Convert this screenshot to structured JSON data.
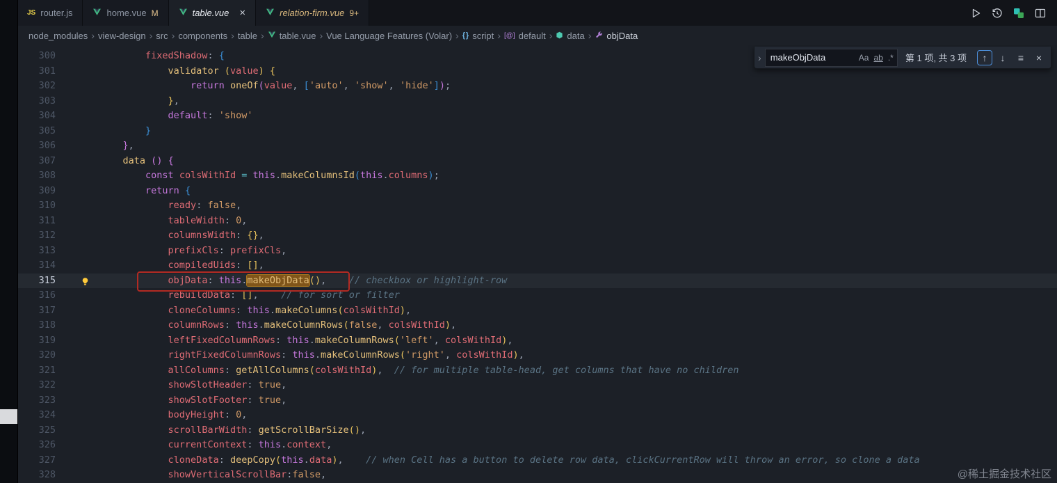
{
  "tabs": [
    {
      "label": "router.js",
      "icon": "js",
      "modified": "",
      "active": false
    },
    {
      "label": "home.vue",
      "icon": "vue",
      "modified": "M",
      "active": false
    },
    {
      "label": "table.vue",
      "icon": "vue",
      "active": true,
      "close": "×"
    },
    {
      "label": "relation-firm.vue",
      "icon": "vue",
      "badge": "9+",
      "active": false
    }
  ],
  "breadcrumb": {
    "separator": "›",
    "items": [
      {
        "label": "node_modules"
      },
      {
        "label": "view-design"
      },
      {
        "label": "src"
      },
      {
        "label": "components"
      },
      {
        "label": "table"
      },
      {
        "label": "table.vue",
        "icon": "vue"
      },
      {
        "label": "Vue Language Features (Volar)"
      },
      {
        "label": "script",
        "icon": "braces"
      },
      {
        "label": "default",
        "icon": "at"
      },
      {
        "label": "data",
        "icon": "field"
      },
      {
        "label": "objData",
        "icon": "wrench"
      }
    ]
  },
  "find": {
    "query": "makeObjData",
    "match_case": "Aa",
    "whole_word": "ab",
    "regex": ".*",
    "results": "第 1 项, 共 3 项"
  },
  "icons": {
    "js_badge": "JS",
    "close": "×",
    "chevron_right": "›",
    "arrow_up": "↑",
    "arrow_down": "↓",
    "selection_lines": "≡"
  },
  "colors": {
    "vue_green": "#41b883",
    "modified_badge": "#e2c08d",
    "find_match_bg": "#80551a",
    "annotation_red": "#b22a23",
    "editor_bg": "#1c2027"
  },
  "watermark": {
    "text": "@稀土掘金技术社区"
  },
  "editor": {
    "lines": [
      {
        "n": 300,
        "t": [
          [
            "        ",
            "w"
          ],
          [
            "fixedShadow",
            "v"
          ],
          [
            ":",
            "p"
          ],
          [
            " ",
            "w"
          ],
          [
            "{",
            "b3"
          ]
        ]
      },
      {
        "n": 301,
        "t": [
          [
            "            ",
            "w"
          ],
          [
            "validator",
            "f"
          ],
          [
            " ",
            "w"
          ],
          [
            "(",
            "b1"
          ],
          [
            "value",
            "v"
          ],
          [
            ")",
            "b1"
          ],
          [
            " ",
            "w"
          ],
          [
            "{",
            "b1"
          ]
        ]
      },
      {
        "n": 302,
        "t": [
          [
            "                ",
            "w"
          ],
          [
            "return",
            "k"
          ],
          [
            " ",
            "w"
          ],
          [
            "oneOf",
            "f"
          ],
          [
            "(",
            "b2"
          ],
          [
            "value",
            "v"
          ],
          [
            ",",
            "p"
          ],
          [
            " ",
            "w"
          ],
          [
            "[",
            "b3"
          ],
          [
            "'auto'",
            "s"
          ],
          [
            ",",
            "p"
          ],
          [
            " ",
            "w"
          ],
          [
            "'show'",
            "s"
          ],
          [
            ",",
            "p"
          ],
          [
            " ",
            "w"
          ],
          [
            "'hide'",
            "s"
          ],
          [
            "]",
            "b3"
          ],
          [
            ")",
            "b2"
          ],
          [
            ";",
            "p"
          ]
        ]
      },
      {
        "n": 303,
        "t": [
          [
            "            ",
            "w"
          ],
          [
            "}",
            "b1"
          ],
          [
            ",",
            "p"
          ]
        ]
      },
      {
        "n": 304,
        "t": [
          [
            "            ",
            "w"
          ],
          [
            "default",
            "k"
          ],
          [
            ":",
            "p"
          ],
          [
            " ",
            "w"
          ],
          [
            "'show'",
            "s"
          ]
        ]
      },
      {
        "n": 305,
        "t": [
          [
            "        ",
            "w"
          ],
          [
            "}",
            "b3"
          ]
        ]
      },
      {
        "n": 306,
        "t": [
          [
            "    ",
            "w"
          ],
          [
            "}",
            "b2"
          ],
          [
            ",",
            "p"
          ]
        ]
      },
      {
        "n": 307,
        "t": [
          [
            "    ",
            "w"
          ],
          [
            "data",
            "f"
          ],
          [
            " ",
            "w"
          ],
          [
            "(",
            "b2"
          ],
          [
            ")",
            "b2"
          ],
          [
            " ",
            "w"
          ],
          [
            "{",
            "b2"
          ]
        ]
      },
      {
        "n": 308,
        "t": [
          [
            "        ",
            "w"
          ],
          [
            "const",
            "k"
          ],
          [
            " ",
            "w"
          ],
          [
            "colsWithId",
            "v"
          ],
          [
            " ",
            "w"
          ],
          [
            "=",
            "o"
          ],
          [
            " ",
            "w"
          ],
          [
            "this",
            "k"
          ],
          [
            ".",
            "p"
          ],
          [
            "makeColumnsId",
            "f"
          ],
          [
            "(",
            "b3"
          ],
          [
            "this",
            "k"
          ],
          [
            ".",
            "p"
          ],
          [
            "columns",
            "v"
          ],
          [
            ")",
            "b3"
          ],
          [
            ";",
            "p"
          ]
        ]
      },
      {
        "n": 309,
        "t": [
          [
            "        ",
            "w"
          ],
          [
            "return",
            "k"
          ],
          [
            " ",
            "w"
          ],
          [
            "{",
            "b3"
          ]
        ]
      },
      {
        "n": 310,
        "t": [
          [
            "            ",
            "w"
          ],
          [
            "ready",
            "v"
          ],
          [
            ":",
            "p"
          ],
          [
            " ",
            "w"
          ],
          [
            "false",
            "n"
          ],
          [
            ",",
            "p"
          ]
        ]
      },
      {
        "n": 311,
        "t": [
          [
            "            ",
            "w"
          ],
          [
            "tableWidth",
            "v"
          ],
          [
            ":",
            "p"
          ],
          [
            " ",
            "w"
          ],
          [
            "0",
            "n"
          ],
          [
            ",",
            "p"
          ]
        ]
      },
      {
        "n": 312,
        "t": [
          [
            "            ",
            "w"
          ],
          [
            "columnsWidth",
            "v"
          ],
          [
            ":",
            "p"
          ],
          [
            " ",
            "w"
          ],
          [
            "{}",
            "b1"
          ],
          [
            ",",
            "p"
          ]
        ]
      },
      {
        "n": 313,
        "t": [
          [
            "            ",
            "w"
          ],
          [
            "prefixCls",
            "v"
          ],
          [
            ":",
            "p"
          ],
          [
            " ",
            "w"
          ],
          [
            "prefixCls",
            "v"
          ],
          [
            ",",
            "p"
          ]
        ]
      },
      {
        "n": 314,
        "t": [
          [
            "            ",
            "w"
          ],
          [
            "compiledUids",
            "v"
          ],
          [
            ":",
            "p"
          ],
          [
            " ",
            "w"
          ],
          [
            "[]",
            "b1"
          ],
          [
            ",",
            "p"
          ]
        ]
      },
      {
        "n": 315,
        "cur": true,
        "bulb": true,
        "t": [
          [
            "            ",
            "w"
          ],
          [
            "objData",
            "v"
          ],
          [
            ":",
            "p"
          ],
          [
            " ",
            "w"
          ],
          [
            "this",
            "k"
          ],
          [
            ".",
            "p"
          ],
          [
            "makeObjData",
            "f hl"
          ],
          [
            "(",
            "b1"
          ],
          [
            ")",
            "b1"
          ],
          [
            ",",
            "p"
          ],
          [
            "    ",
            "w"
          ],
          [
            "// checkbox or highlight-row",
            "c"
          ]
        ]
      },
      {
        "n": 316,
        "t": [
          [
            "            ",
            "w"
          ],
          [
            "rebuildData",
            "v"
          ],
          [
            ":",
            "p"
          ],
          [
            " ",
            "w"
          ],
          [
            "[]",
            "b1"
          ],
          [
            ",",
            "p"
          ],
          [
            "    ",
            "w"
          ],
          [
            "// for sort or filter",
            "c"
          ]
        ]
      },
      {
        "n": 317,
        "t": [
          [
            "            ",
            "w"
          ],
          [
            "cloneColumns",
            "v"
          ],
          [
            ":",
            "p"
          ],
          [
            " ",
            "w"
          ],
          [
            "this",
            "k"
          ],
          [
            ".",
            "p"
          ],
          [
            "makeColumns",
            "f"
          ],
          [
            "(",
            "b1"
          ],
          [
            "colsWithId",
            "v"
          ],
          [
            ")",
            "b1"
          ],
          [
            ",",
            "p"
          ]
        ]
      },
      {
        "n": 318,
        "t": [
          [
            "            ",
            "w"
          ],
          [
            "columnRows",
            "v"
          ],
          [
            ":",
            "p"
          ],
          [
            " ",
            "w"
          ],
          [
            "this",
            "k"
          ],
          [
            ".",
            "p"
          ],
          [
            "makeColumnRows",
            "f"
          ],
          [
            "(",
            "b1"
          ],
          [
            "false",
            "n"
          ],
          [
            ",",
            "p"
          ],
          [
            " ",
            "w"
          ],
          [
            "colsWithId",
            "v"
          ],
          [
            ")",
            "b1"
          ],
          [
            ",",
            "p"
          ]
        ]
      },
      {
        "n": 319,
        "t": [
          [
            "            ",
            "w"
          ],
          [
            "leftFixedColumnRows",
            "v"
          ],
          [
            ":",
            "p"
          ],
          [
            " ",
            "w"
          ],
          [
            "this",
            "k"
          ],
          [
            ".",
            "p"
          ],
          [
            "makeColumnRows",
            "f"
          ],
          [
            "(",
            "b1"
          ],
          [
            "'left'",
            "s"
          ],
          [
            ",",
            "p"
          ],
          [
            " ",
            "w"
          ],
          [
            "colsWithId",
            "v"
          ],
          [
            ")",
            "b1"
          ],
          [
            ",",
            "p"
          ]
        ]
      },
      {
        "n": 320,
        "t": [
          [
            "            ",
            "w"
          ],
          [
            "rightFixedColumnRows",
            "v"
          ],
          [
            ":",
            "p"
          ],
          [
            " ",
            "w"
          ],
          [
            "this",
            "k"
          ],
          [
            ".",
            "p"
          ],
          [
            "makeColumnRows",
            "f"
          ],
          [
            "(",
            "b1"
          ],
          [
            "'right'",
            "s"
          ],
          [
            ",",
            "p"
          ],
          [
            " ",
            "w"
          ],
          [
            "colsWithId",
            "v"
          ],
          [
            ")",
            "b1"
          ],
          [
            ",",
            "p"
          ]
        ]
      },
      {
        "n": 321,
        "t": [
          [
            "            ",
            "w"
          ],
          [
            "allColumns",
            "v"
          ],
          [
            ":",
            "p"
          ],
          [
            " ",
            "w"
          ],
          [
            "getAllColumns",
            "f"
          ],
          [
            "(",
            "b1"
          ],
          [
            "colsWithId",
            "v"
          ],
          [
            ")",
            "b1"
          ],
          [
            ",",
            "p"
          ],
          [
            "  ",
            "w"
          ],
          [
            "// for multiple table-head, get columns that have no children",
            "c"
          ]
        ]
      },
      {
        "n": 322,
        "t": [
          [
            "            ",
            "w"
          ],
          [
            "showSlotHeader",
            "v"
          ],
          [
            ":",
            "p"
          ],
          [
            " ",
            "w"
          ],
          [
            "true",
            "n"
          ],
          [
            ",",
            "p"
          ]
        ]
      },
      {
        "n": 323,
        "t": [
          [
            "            ",
            "w"
          ],
          [
            "showSlotFooter",
            "v"
          ],
          [
            ":",
            "p"
          ],
          [
            " ",
            "w"
          ],
          [
            "true",
            "n"
          ],
          [
            ",",
            "p"
          ]
        ]
      },
      {
        "n": 324,
        "t": [
          [
            "            ",
            "w"
          ],
          [
            "bodyHeight",
            "v"
          ],
          [
            ":",
            "p"
          ],
          [
            " ",
            "w"
          ],
          [
            "0",
            "n"
          ],
          [
            ",",
            "p"
          ]
        ]
      },
      {
        "n": 325,
        "t": [
          [
            "            ",
            "w"
          ],
          [
            "scrollBarWidth",
            "v"
          ],
          [
            ":",
            "p"
          ],
          [
            " ",
            "w"
          ],
          [
            "getScrollBarSize",
            "f"
          ],
          [
            "(",
            "b1"
          ],
          [
            ")",
            "b1"
          ],
          [
            ",",
            "p"
          ]
        ]
      },
      {
        "n": 326,
        "t": [
          [
            "            ",
            "w"
          ],
          [
            "currentContext",
            "v"
          ],
          [
            ":",
            "p"
          ],
          [
            " ",
            "w"
          ],
          [
            "this",
            "k"
          ],
          [
            ".",
            "p"
          ],
          [
            "context",
            "v"
          ],
          [
            ",",
            "p"
          ]
        ]
      },
      {
        "n": 327,
        "t": [
          [
            "            ",
            "w"
          ],
          [
            "cloneData",
            "v"
          ],
          [
            ":",
            "p"
          ],
          [
            " ",
            "w"
          ],
          [
            "deepCopy",
            "f"
          ],
          [
            "(",
            "b1"
          ],
          [
            "this",
            "k"
          ],
          [
            ".",
            "p"
          ],
          [
            "data",
            "v"
          ],
          [
            ")",
            "b1"
          ],
          [
            ",",
            "p"
          ],
          [
            "    ",
            "w"
          ],
          [
            "// when Cell has a button to delete row data, clickCurrentRow will throw an error, so clone a data",
            "c"
          ]
        ]
      },
      {
        "n": 328,
        "t": [
          [
            "            ",
            "w"
          ],
          [
            "showVerticalScrollBar",
            "v"
          ],
          [
            ":",
            "p"
          ],
          [
            "false",
            "n"
          ],
          [
            ",",
            "p"
          ]
        ]
      }
    ]
  }
}
